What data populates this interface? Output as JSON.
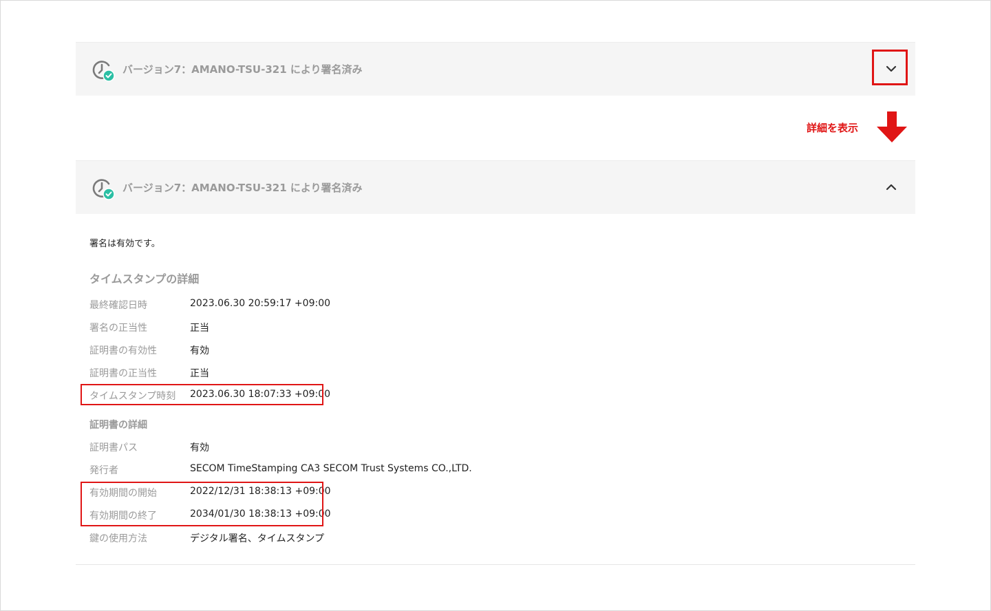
{
  "signature_panel": {
    "title": "バージョン7：AMANO-TSU-321 により署名済み",
    "icon": "clock-check-icon",
    "collapse_icon": "chevron-down-icon",
    "expand_icon": "chevron-up-icon"
  },
  "annotation": {
    "text": "詳細を表示",
    "arrow_icon": "arrow-down-icon",
    "color": "#e01515"
  },
  "details": {
    "status": "署名は有効です。",
    "timestamp_heading": "タイムスタンプの詳細",
    "timestamp_rows": [
      {
        "label": "最終確認日時",
        "value": "2023.06.30 20:59:17 +09:00"
      },
      {
        "label": "署名の正当性",
        "value": "正当"
      },
      {
        "label": "証明書の有効性",
        "value": "有効"
      },
      {
        "label": "証明書の正当性",
        "value": "正当"
      },
      {
        "label": "タイムスタンプ時刻",
        "value": "2023.06.30 18:07:33 +09:00"
      }
    ],
    "certificate_heading": "証明書の詳細",
    "certificate_rows": [
      {
        "label": "証明書パス",
        "value": "有効"
      },
      {
        "label": "発行者",
        "value": "SECOM TimeStamping CA3 SECOM Trust Systems CO.,LTD."
      },
      {
        "label": "有効期間の開始",
        "value": "2022/12/31 18:38:13 +09:00"
      },
      {
        "label": "有効期間の終了",
        "value": "2034/01/30 18:38:13 +09:00"
      },
      {
        "label": "鍵の使用方法",
        "value": "デジタル署名、タイムスタンプ"
      }
    ]
  },
  "colors": {
    "accent_check": "#2bbfa4",
    "label_gray": "#9a9a9a",
    "header_bg": "#f5f5f5"
  }
}
